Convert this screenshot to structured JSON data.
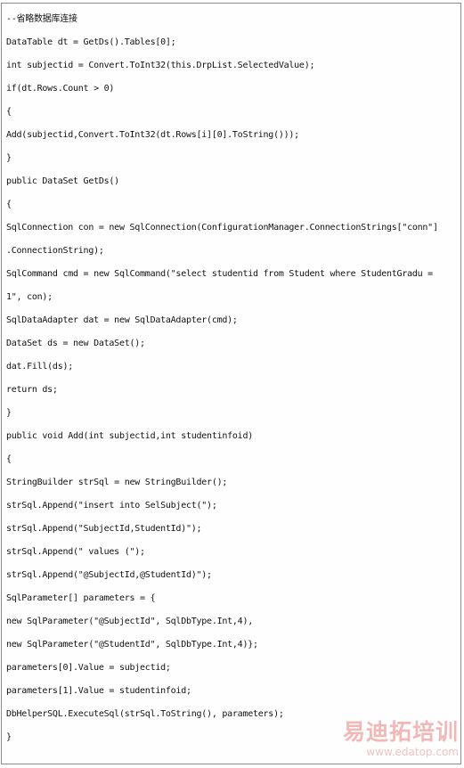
{
  "code_lines": [
    "--省略数据库连接",
    "DataTable dt = GetDs().Tables[0];",
    "int subjectid = Convert.ToInt32(this.DrpList.SelectedValue);",
    "if(dt.Rows.Count > 0)",
    "{",
    "Add(subjectid,Convert.ToInt32(dt.Rows[i][0].ToString()));",
    "}",
    "public DataSet GetDs()",
    "{",
    "SqlConnection con = new SqlConnection(ConfigurationManager.ConnectionStrings[\"conn\"]",
    ".ConnectionString);",
    "SqlCommand cmd = new SqlCommand(\"select studentid from Student where StudentGradu =",
    "1\", con);",
    "SqlDataAdapter dat = new SqlDataAdapter(cmd);",
    "DataSet ds = new DataSet();",
    "dat.Fill(ds);",
    "return ds;",
    "}",
    "public void Add(int subjectid,int studentinfoid)",
    "{",
    "StringBuilder strSql = new StringBuilder();",
    "strSql.Append(\"insert into SelSubject(\");",
    "strSql.Append(\"SubjectId,StudentId)\");",
    "strSql.Append(\" values (\");",
    "strSql.Append(\"@SubjectId,@StudentId)\");",
    "SqlParameter[] parameters = {",
    "new SqlParameter(\"@SubjectId\", SqlDbType.Int,4),",
    "new SqlParameter(\"@StudentId\", SqlDbType.Int,4)};",
    "parameters[0].Value = subjectid;",
    "parameters[1].Value = studentinfoid;",
    "DbHelperSQL.ExecuteSql(strSql.ToString(), parameters);",
    "}"
  ],
  "watermark": {
    "logo": "易迪拓培训",
    "url": "www.edatop.com"
  }
}
